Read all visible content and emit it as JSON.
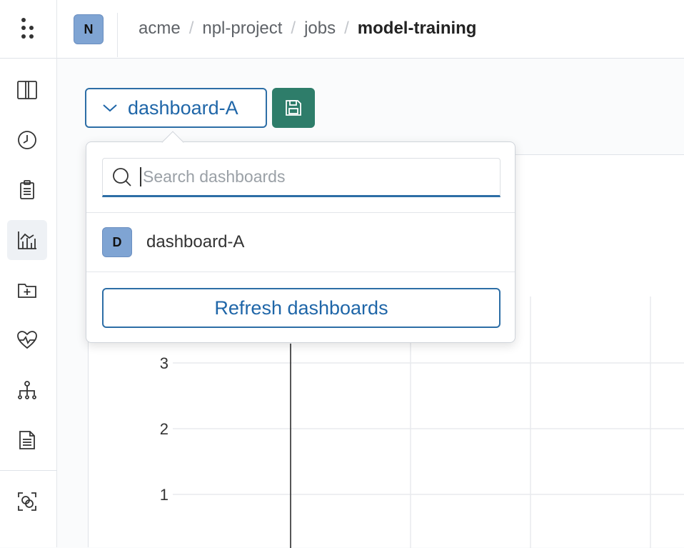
{
  "header": {
    "avatar_initial": "N",
    "breadcrumb": [
      "acme",
      "npl-project",
      "jobs"
    ],
    "breadcrumb_current": "model-training",
    "separator": "/"
  },
  "sidebar": {
    "items": [
      {
        "icon": "panel-split-icon"
      },
      {
        "icon": "clock-icon"
      },
      {
        "icon": "clipboard-icon"
      },
      {
        "icon": "chart-analytics-icon",
        "active": true
      },
      {
        "icon": "folder-add-icon"
      },
      {
        "icon": "heartbeat-icon"
      },
      {
        "icon": "hierarchy-icon"
      },
      {
        "icon": "document-icon"
      },
      {
        "icon": "scan-icon"
      }
    ]
  },
  "toolbar": {
    "dashboard_label": "dashboard-A",
    "save_icon": "save-icon"
  },
  "popover": {
    "search_placeholder": "Search dashboards",
    "items": [
      {
        "initial": "D",
        "label": "dashboard-A"
      }
    ],
    "refresh_label": "Refresh dashboards"
  },
  "chart_data": {
    "type": "line",
    "y_ticks": [
      "3",
      "2",
      "1"
    ],
    "grid": true
  },
  "colors": {
    "accent": "#2d6ea6",
    "save_button": "#2e7d6a",
    "avatar": "#7fa4d3"
  }
}
